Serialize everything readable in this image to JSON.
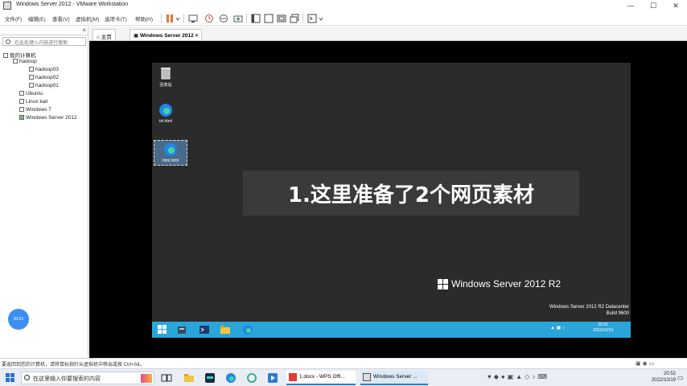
{
  "window": {
    "title": "Windows Server 2012 - VMware Workstation",
    "minimize": "—",
    "maximize": "☐",
    "close": "✕"
  },
  "menu": [
    "文件(F)",
    "编辑(E)",
    "查看(V)",
    "虚拟机(M)",
    "选项卡(T)",
    "帮助(H)"
  ],
  "library": {
    "close": "×",
    "search_placeholder": "在此处键入内容进行搜索",
    "tree": [
      {
        "label": "我的计算机",
        "level": 0
      },
      {
        "label": "hadoop",
        "level": 1
      },
      {
        "label": "hadoop03",
        "level": 2
      },
      {
        "label": "hadoop02",
        "level": 2
      },
      {
        "label": "hadoop01",
        "level": 2
      },
      {
        "label": "Ubuntu",
        "level": 1
      },
      {
        "label": "Linux kali",
        "level": 1
      },
      {
        "label": "Windows 7",
        "level": 1
      },
      {
        "label": "Windows Server 2012",
        "level": 1
      }
    ],
    "record_button": "00:01"
  },
  "tabs": [
    {
      "label": "主页"
    },
    {
      "label": "Windows Server 2012"
    }
  ],
  "guest": {
    "icons": [
      {
        "label": "回收站"
      },
      {
        "label": "txt.html"
      },
      {
        "label": "html.html"
      }
    ],
    "overlay_text": "1.这里准备了2个网页素材",
    "brand": "Windows Server 2012 R2",
    "watermark_line1": "Windows Server 2012 R2 Datacenter",
    "watermark_line2": "Build 9600",
    "tray_time": "20:52",
    "tray_date": "2022/10/19"
  },
  "status_bar": "要返回到您的计算机，请将鼠标指针从虚拟机中移出或按 Ctrl+Alt。",
  "taskbar": {
    "search_placeholder": "在这里输入你要搜索的内容",
    "apps": [
      {
        "label": "1.docx - WPS Offi..."
      },
      {
        "label": "Windows Server ..."
      }
    ],
    "time": "20:52",
    "date": "2022/10/19"
  }
}
